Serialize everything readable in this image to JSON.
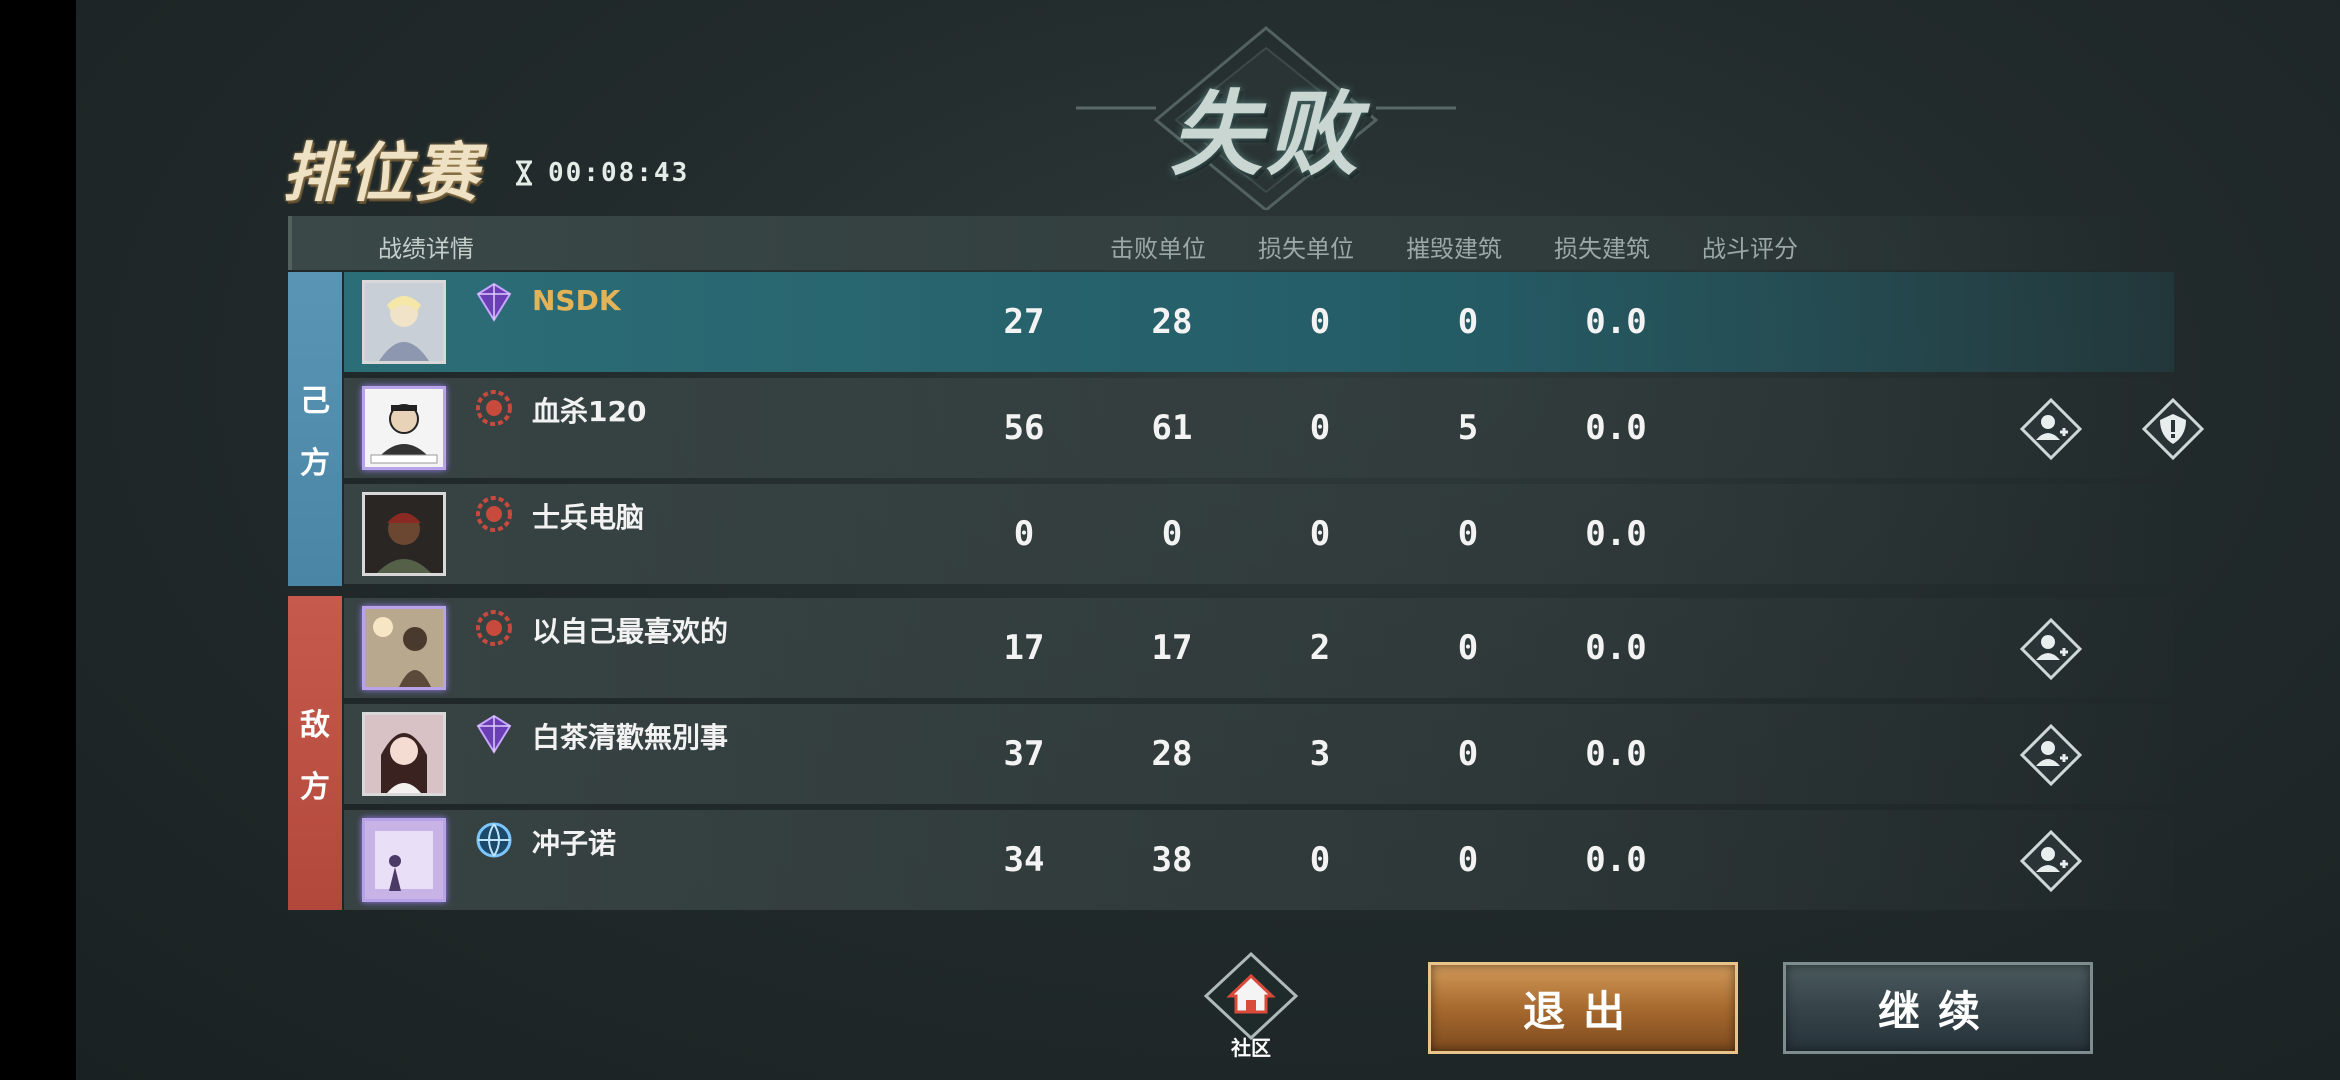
{
  "result_title": "失败",
  "mode_title": "排位赛",
  "timer": "00:08:43",
  "table": {
    "headers": [
      "战绩详情",
      "击败单位",
      "损失单位",
      "摧毁建筑",
      "损失建筑",
      "战斗评分"
    ]
  },
  "sides": {
    "own_label_1": "己",
    "own_label_2": "方",
    "enemy_label_1": "敌",
    "enemy_label_2": "方"
  },
  "players": [
    {
      "name": "NSDK",
      "kills": "27",
      "losses": "28",
      "destroyed": "0",
      "lost_buildings": "0",
      "score": "0.0",
      "rank_icon": "purple-crystal-rank-icon",
      "team": "own"
    },
    {
      "name": "血杀120",
      "kills": "56",
      "losses": "61",
      "destroyed": "0",
      "lost_buildings": "5",
      "score": "0.0",
      "rank_icon": "red-gear-rank-icon",
      "team": "own"
    },
    {
      "name": "士兵电脑",
      "kills": "0",
      "losses": "0",
      "destroyed": "0",
      "lost_buildings": "0",
      "score": "0.0",
      "rank_icon": "red-gear-rank-icon",
      "team": "own"
    },
    {
      "name": "以自己最喜欢的",
      "kills": "17",
      "losses": "17",
      "destroyed": "2",
      "lost_buildings": "0",
      "score": "0.0",
      "rank_icon": "red-gear-rank-icon",
      "team": "enemy"
    },
    {
      "name": "白茶清歡無別事",
      "kills": "37",
      "losses": "28",
      "destroyed": "3",
      "lost_buildings": "0",
      "score": "0.0",
      "rank_icon": "purple-crystal-rank-icon",
      "team": "enemy"
    },
    {
      "name": "冲子诺",
      "kills": "34",
      "losses": "38",
      "destroyed": "0",
      "lost_buildings": "0",
      "score": "0.0",
      "rank_icon": "blue-globe-rank-icon",
      "team": "enemy"
    }
  ],
  "buttons": {
    "home_label": "社区",
    "exit": "退出",
    "continue": "继续"
  },
  "colors": {
    "own_side": "#4a85a6",
    "enemy_side": "#b2483c",
    "self_row": "#2c6e78",
    "self_name": "#e3b358",
    "exit_button": "#a86a2f"
  }
}
